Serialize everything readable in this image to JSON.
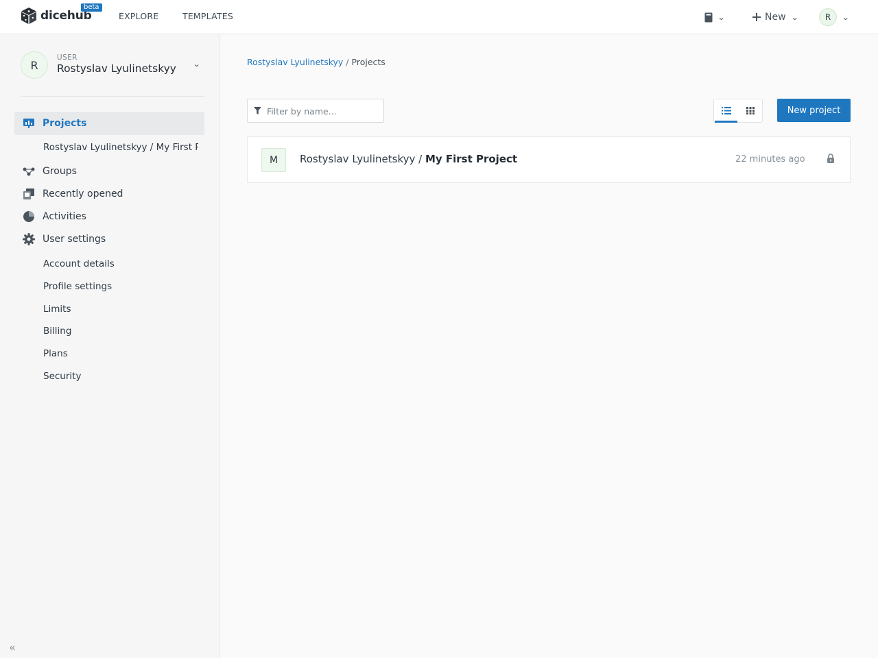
{
  "app": {
    "name": "dicehub",
    "badge": "beta"
  },
  "topnav": {
    "links": [
      "EXPLORE",
      "TEMPLATES"
    ],
    "new_label": "New",
    "user_initial": "R"
  },
  "sidebar": {
    "user_label": "USER",
    "user_name": "Rostyslav Lyulinetskyy",
    "user_initial": "R",
    "items": [
      {
        "label": "Projects",
        "icon": "projects-icon",
        "active": true
      },
      {
        "label": "Groups",
        "icon": "groups-icon"
      },
      {
        "label": "Recently opened",
        "icon": "recent-icon"
      },
      {
        "label": "Activities",
        "icon": "activities-icon"
      },
      {
        "label": "User settings",
        "icon": "gear-icon"
      }
    ],
    "project_sub": "Rostyslav Lyulinetskyy / My First Project",
    "settings_sub": [
      "Account details",
      "Profile settings",
      "Limits",
      "Billing",
      "Plans",
      "Security"
    ],
    "collapse": "«"
  },
  "breadcrumb": {
    "link": "Rostyslav Lyulinetskyy",
    "separator": "/",
    "current": "Projects"
  },
  "toolbar": {
    "filter_placeholder": "Filter by name...",
    "new_project_label": "New project"
  },
  "projects": [
    {
      "initial": "M",
      "owner": "Rostyslav Lyulinetskyy / ",
      "name": "My First Project",
      "time": "22 minutes ago"
    }
  ],
  "colors": {
    "accent": "#1f77c0",
    "avatar_bg": "#eef8ee"
  }
}
